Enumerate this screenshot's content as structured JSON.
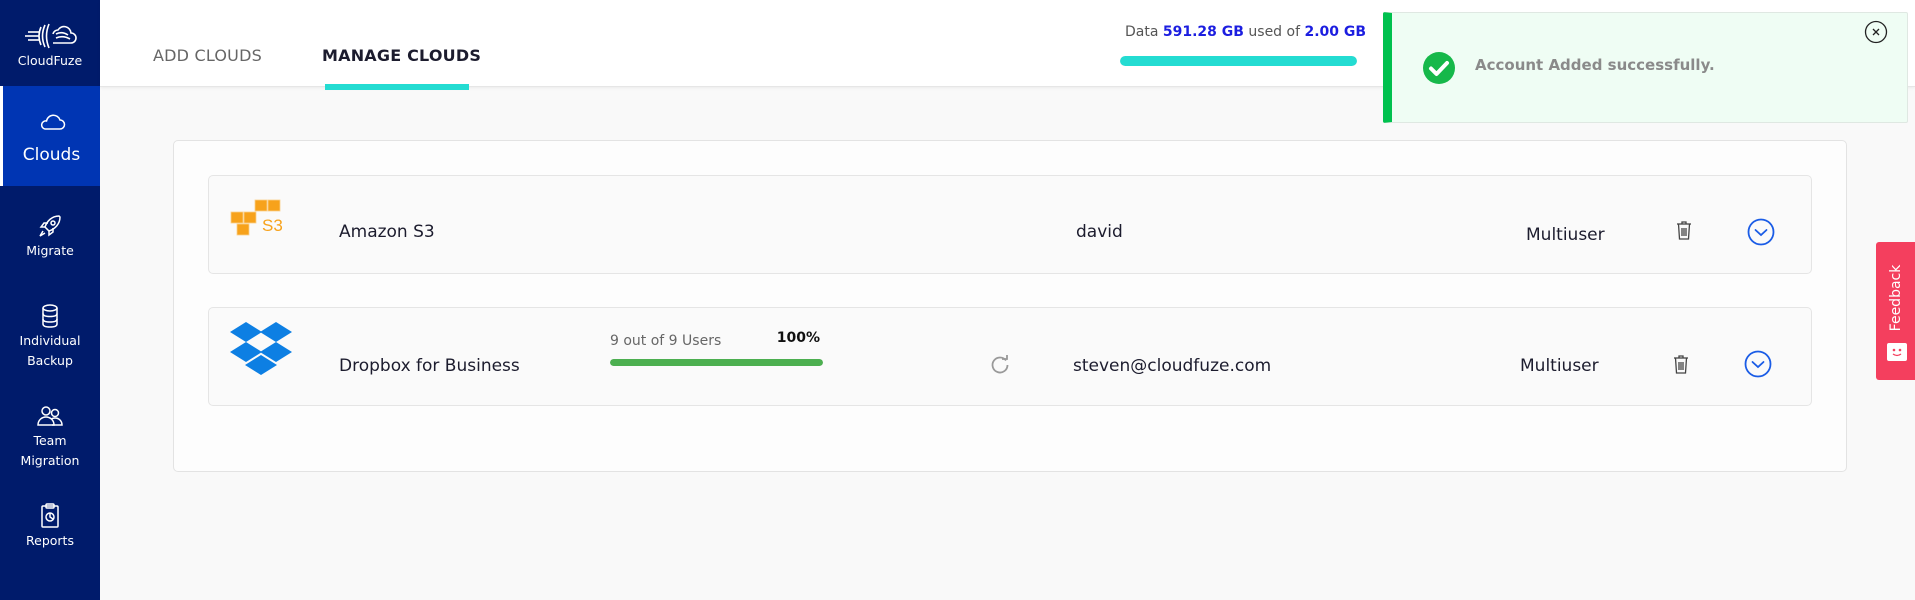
{
  "app": {
    "brand": "CloudFuze"
  },
  "sidebar": {
    "items": [
      {
        "label": "Clouds",
        "icon": "cloud-icon",
        "active": true
      },
      {
        "label": "Migrate",
        "icon": "rocket-icon"
      },
      {
        "label": "Individual Backup",
        "line1": "Individual",
        "line2": "Backup",
        "icon": "database-icon"
      },
      {
        "label": "Team Migration",
        "line1": "Team",
        "line2": "Migration",
        "icon": "users-icon"
      },
      {
        "label": "Reports",
        "icon": "clipboard-report-icon"
      }
    ]
  },
  "header": {
    "tabs": [
      {
        "label": "ADD CLOUDS",
        "active": false
      },
      {
        "label": "MANAGE CLOUDS",
        "active": true
      }
    ],
    "usage": {
      "prefix": "Data",
      "used": "591.28 GB",
      "middle": "used of",
      "total": "2.00 GB",
      "fill_percent": 100
    }
  },
  "toast": {
    "message": "Account Added successfully.",
    "type": "success"
  },
  "clouds": [
    {
      "name": "Amazon S3",
      "logo": "amazon-s3-logo",
      "user": "david",
      "account_type": "Multiuser"
    },
    {
      "name": "Dropbox for Business",
      "logo": "dropbox-logo",
      "sync_text": "9 out of 9 Users",
      "sync_percent_label": "100%",
      "sync_percent": 100,
      "user": "steven@cloudfuze.com",
      "account_type": "Multiuser"
    }
  ],
  "feedback": {
    "label": "Feedback"
  },
  "colors": {
    "sidebar": "#001b6b",
    "sidebar_active": "#0035b3",
    "accent_teal": "#24dcd2",
    "success": "#00c14e",
    "progress_green": "#4caf50",
    "link_blue": "#1c1ee0",
    "feedback_red": "#f43f5e"
  }
}
